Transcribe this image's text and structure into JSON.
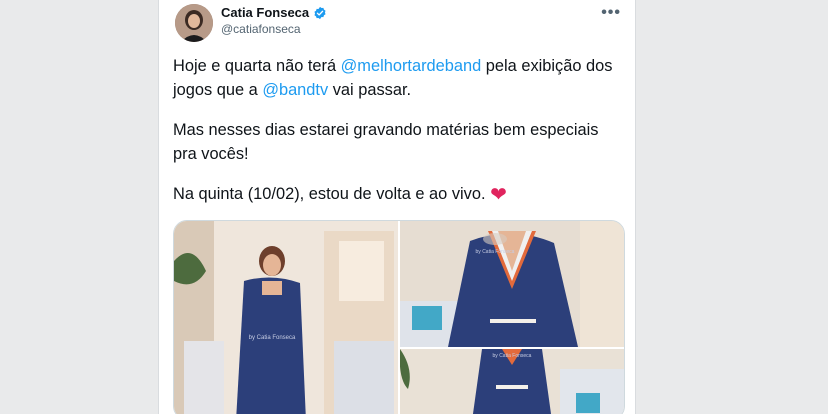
{
  "tweet": {
    "display_name": "Catia Fonseca",
    "handle": "@catiafonseca",
    "more_label": "•••",
    "paragraph1": {
      "part1": "Hoje e quarta não terá ",
      "mention1": "@melhortardeband",
      "part2": " pela exibição dos jogos que a ",
      "mention2": "@bandtv",
      "part3": " vai passar."
    },
    "paragraph2": "Mas nesses dias estarei gravando matérias bem especiais pra vocês!",
    "paragraph3": "Na quinta (10/02), estou de volta e ao vivo.",
    "heart": "❤"
  },
  "media": {
    "watermark": "by Catia Fonseca"
  },
  "icons": {
    "verified": "verified-badge-icon",
    "more": "more-horizontal-icon"
  },
  "colors": {
    "accent": "#1d9bf0",
    "text": "#0f1419",
    "muted": "#536471",
    "heart": "#e0245e",
    "dress": "#2c3f7a"
  }
}
